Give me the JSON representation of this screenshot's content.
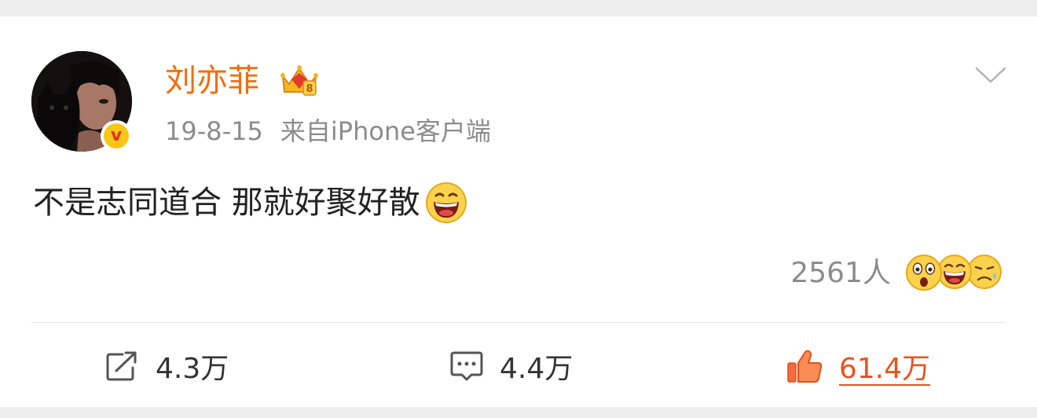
{
  "post": {
    "author": {
      "name": "刘亦菲",
      "verified_icon": "verified-v-badge-icon",
      "vip_icon": "vip-crown-icon"
    },
    "date": "19-8-15",
    "source": "来自iPhone客户端",
    "content": "不是志同道合 那就好聚好散",
    "content_emoji": "laughing-emoji-icon",
    "more_icon": "chevron-down-icon",
    "reactions": {
      "count_label": "2561人",
      "emojis": [
        "surprised-emoji-icon",
        "laughing-emoji-icon",
        "sad-emoji-icon"
      ]
    }
  },
  "actions": {
    "repost": {
      "icon": "share-icon",
      "count": "4.3万"
    },
    "comment": {
      "icon": "comment-icon",
      "count": "4.4万"
    },
    "like": {
      "icon": "thumbs-up-icon",
      "count": "61.4万",
      "active": true
    }
  },
  "colors": {
    "username": "#f36c0c",
    "meta": "#8c8c8c",
    "like_active": "#e8541e",
    "page_background": "#ededed",
    "card_background": "#ffffff"
  }
}
